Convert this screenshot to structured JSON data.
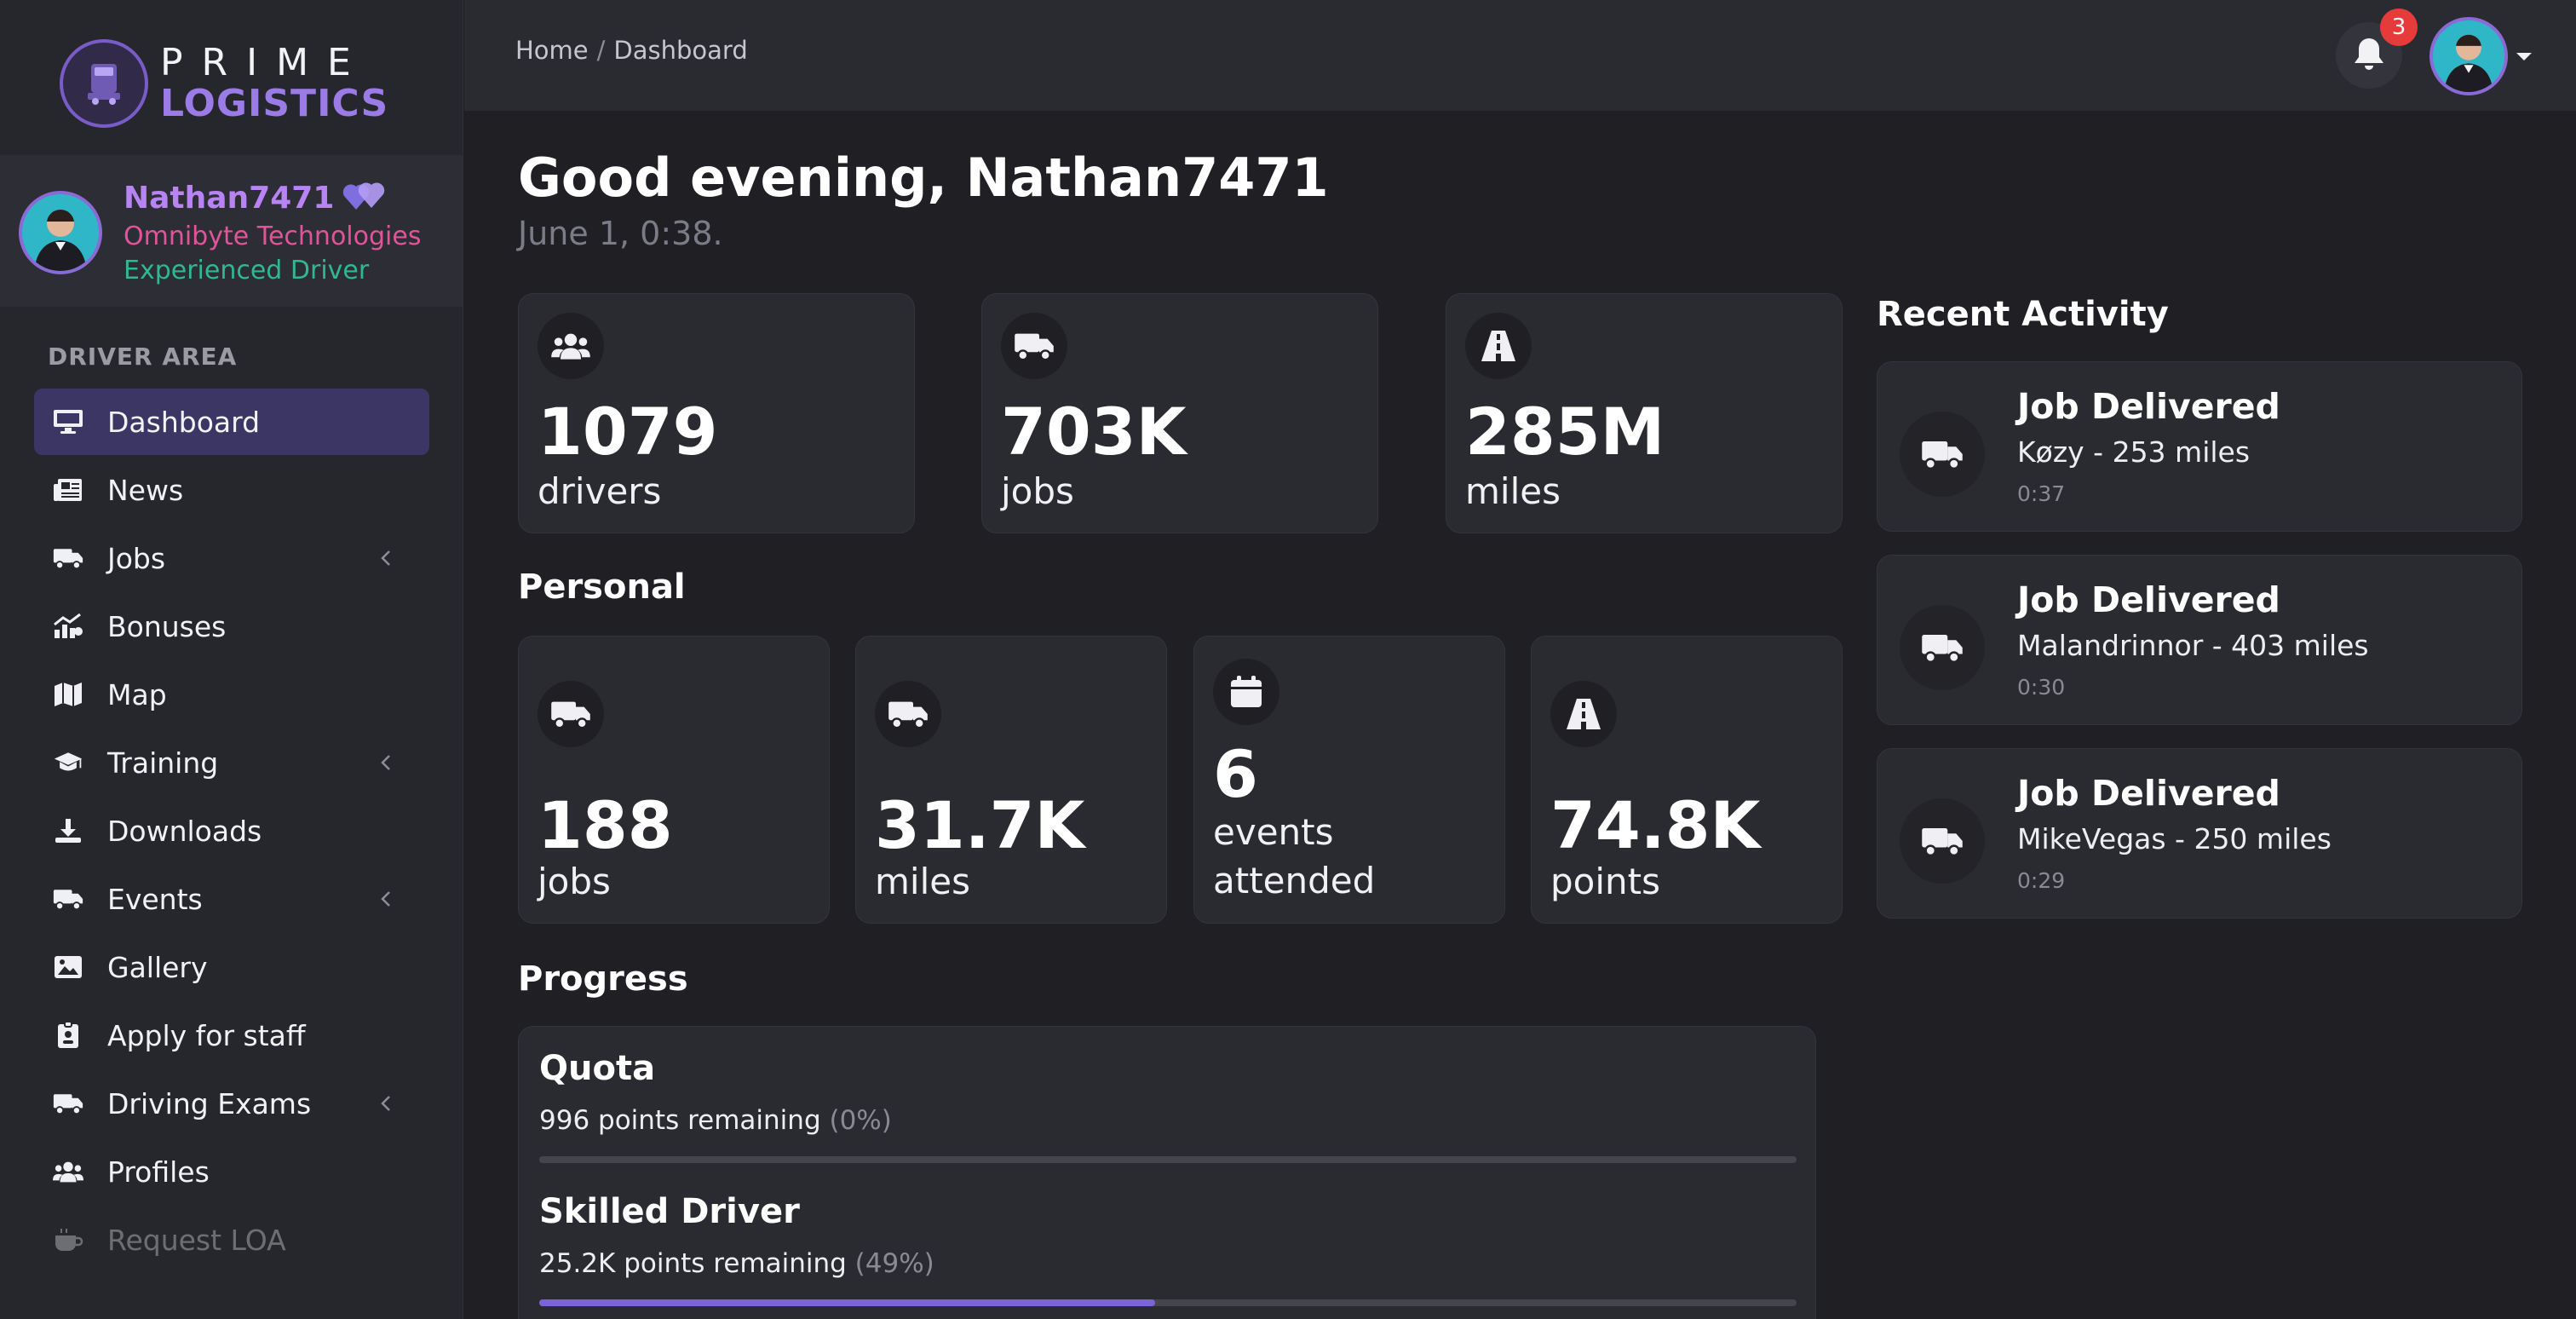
{
  "brand": {
    "line1": "PRIME",
    "line2": "LOGISTICS"
  },
  "user": {
    "name": "Nathan7471",
    "company": "Omnibyte Technologies",
    "role": "Experienced Driver"
  },
  "sidebar": {
    "section": "DRIVER AREA",
    "items": [
      {
        "label": "Dashboard",
        "icon": "monitor-icon",
        "active": true,
        "chevron": false
      },
      {
        "label": "News",
        "icon": "newspaper-icon",
        "active": false,
        "chevron": false
      },
      {
        "label": "Jobs",
        "icon": "truck-icon",
        "active": false,
        "chevron": true
      },
      {
        "label": "Bonuses",
        "icon": "chart-icon",
        "active": false,
        "chevron": false
      },
      {
        "label": "Map",
        "icon": "map-icon",
        "active": false,
        "chevron": false
      },
      {
        "label": "Training",
        "icon": "graduation-cap-icon",
        "active": false,
        "chevron": true
      },
      {
        "label": "Downloads",
        "icon": "download-icon",
        "active": false,
        "chevron": false
      },
      {
        "label": "Events",
        "icon": "truck-icon",
        "active": false,
        "chevron": true
      },
      {
        "label": "Gallery",
        "icon": "image-icon",
        "active": false,
        "chevron": false
      },
      {
        "label": "Apply for staff",
        "icon": "badge-icon",
        "active": false,
        "chevron": false
      },
      {
        "label": "Driving Exams",
        "icon": "truck-icon",
        "active": false,
        "chevron": true
      },
      {
        "label": "Profiles",
        "icon": "users-icon",
        "active": false,
        "chevron": false
      },
      {
        "label": "Request LOA",
        "icon": "coffee-icon",
        "active": false,
        "chevron": false
      }
    ]
  },
  "topbar": {
    "breadcrumb_home": "Home",
    "breadcrumb_sep": "/",
    "breadcrumb_current": "Dashboard",
    "notification_count": "3"
  },
  "greeting": {
    "text": "Good evening, Nathan7471",
    "time": "June 1, 0:38."
  },
  "global_stats": [
    {
      "value": "1079",
      "label": "drivers",
      "icon": "users-icon"
    },
    {
      "value": "703K",
      "label": "jobs",
      "icon": "truck-icon"
    },
    {
      "value": "285M",
      "label": "miles",
      "icon": "road-icon"
    }
  ],
  "personal": {
    "title": "Personal",
    "stats": [
      {
        "value": "188",
        "label": "jobs",
        "icon": "truck-icon"
      },
      {
        "value": "31.7K",
        "label": "miles",
        "icon": "truck-icon"
      },
      {
        "value": "6",
        "label_line1": "events",
        "label_line2": "attended",
        "icon": "calendar-icon"
      },
      {
        "value": "74.8K",
        "label": "points",
        "icon": "road-icon"
      }
    ]
  },
  "recent_activity": {
    "title": "Recent Activity",
    "items": [
      {
        "title": "Job Delivered",
        "desc": "Køzy - 253 miles",
        "time": "0:37"
      },
      {
        "title": "Job Delivered",
        "desc": "Malandrinnor - 403 miles",
        "time": "0:30"
      },
      {
        "title": "Job Delivered",
        "desc": "MikeVegas - 250 miles",
        "time": "0:29"
      }
    ]
  },
  "progress": {
    "title": "Progress",
    "items": [
      {
        "name": "Quota",
        "remaining": "996 points remaining",
        "percent_text": "(0%)",
        "percent": 0
      },
      {
        "name": "Skilled Driver",
        "remaining": "25.2K points remaining",
        "percent_text": "(49%)",
        "percent": 49
      }
    ]
  },
  "colors": {
    "accent": "#7b63dc",
    "active_nav": "#3b3663",
    "badge": "#e63b3b",
    "name": "#b884f4",
    "company": "#e0559a",
    "role": "#2fb892"
  }
}
